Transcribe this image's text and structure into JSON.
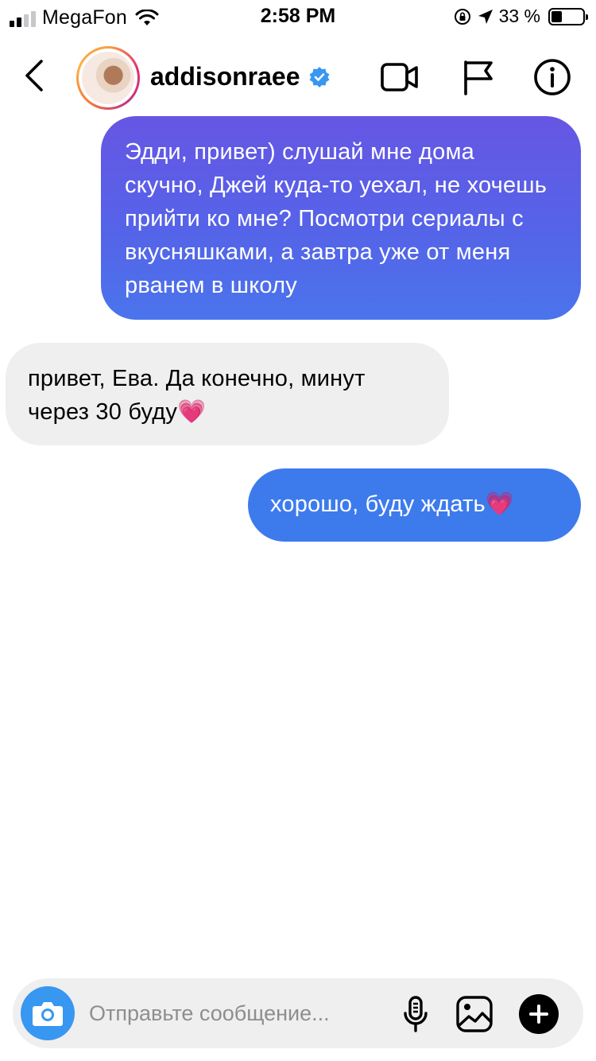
{
  "status_bar": {
    "carrier": "MegaFon",
    "time": "2:58 PM",
    "battery_text": "33 %",
    "battery_level": 0.33,
    "signal_bars_active": 2,
    "signal_bars_total": 4
  },
  "header": {
    "username": "addisonraee",
    "verified": true
  },
  "messages": [
    {
      "direction": "outgoing",
      "text": "Эдди, привет) слушай мне дома скучно, Джей куда-то уехал, не хочешь прийти ко мне? Посмотри сериалы с вкусняшками, а завтра уже от меня рванем в школу"
    },
    {
      "direction": "incoming",
      "text": "привет, Ева. Да конечно, минут через 30 буду💗"
    },
    {
      "direction": "outgoing",
      "text": "хорошо, буду ждать💗"
    }
  ],
  "composer": {
    "placeholder": "Отправьте сообщение..."
  },
  "colors": {
    "accent_blue": "#3d7bed",
    "bubble_purple": "#6656e4",
    "incoming_bubble": "#efefef",
    "camera_button": "#3897f0",
    "verified_badge": "#3897f0"
  },
  "icons": {
    "back": "chevron-left-icon",
    "video": "video-camera-icon",
    "flag": "flag-icon",
    "info": "info-icon",
    "camera": "camera-icon",
    "mic": "microphone-icon",
    "gallery": "image-icon",
    "plus": "plus-icon"
  }
}
